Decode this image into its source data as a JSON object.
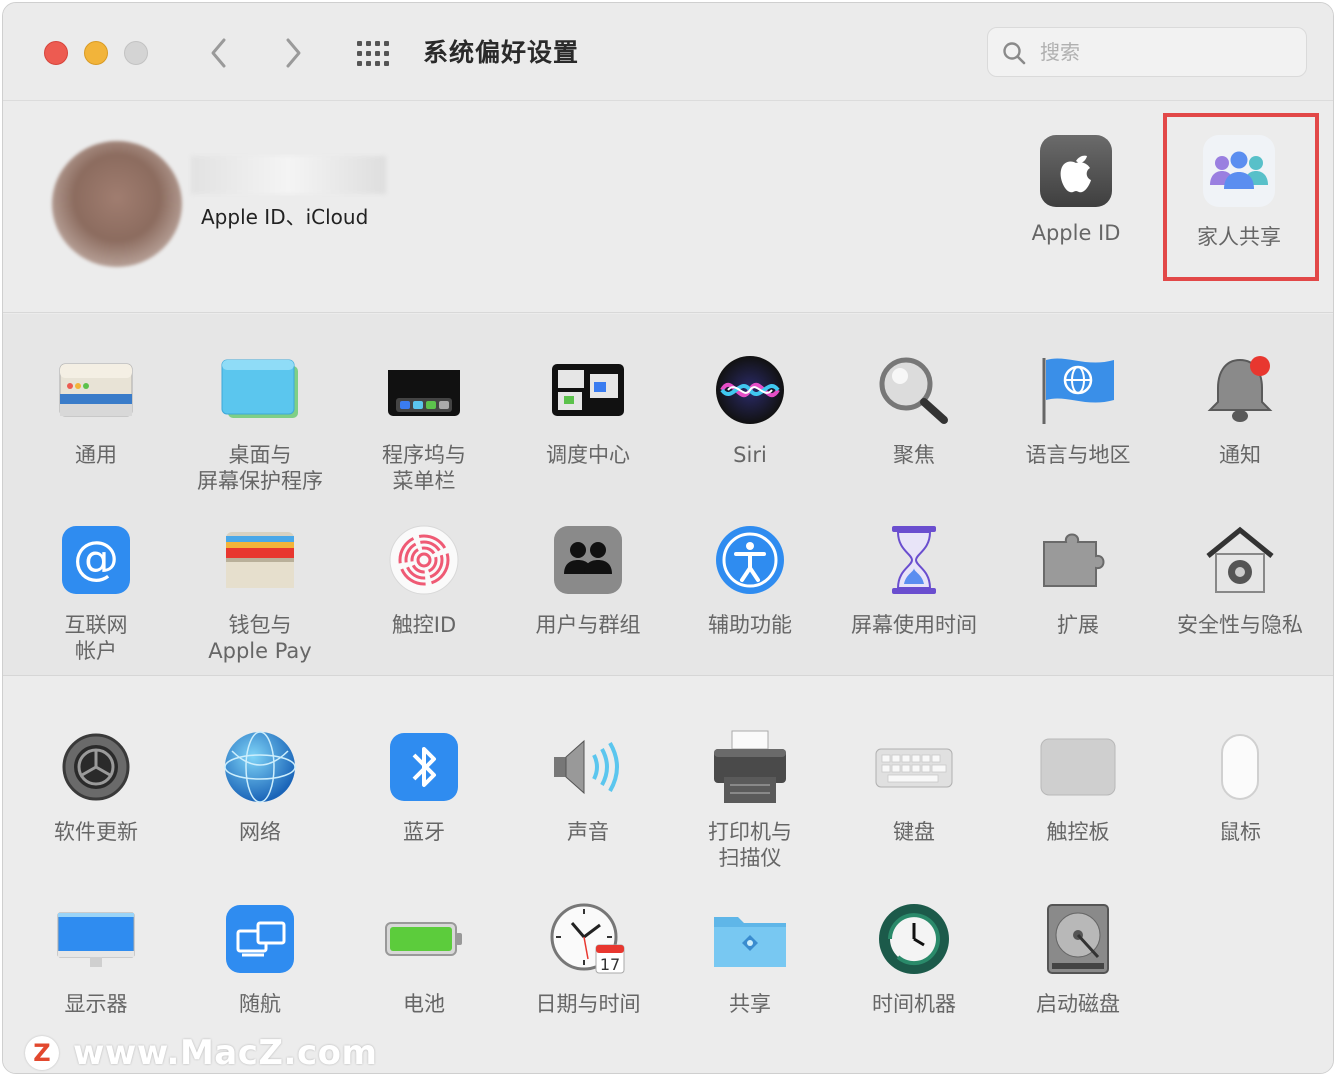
{
  "window": {
    "title": "系统偏好设置",
    "search_placeholder": "搜索"
  },
  "account": {
    "name": "",
    "subtitle": "Apple ID、iCloud",
    "apple_id_label": "Apple ID",
    "family_label": "家人共享"
  },
  "section1": [
    {
      "label": "通用",
      "icon": "general-icon"
    },
    {
      "label": "桌面与\n屏幕保护程序",
      "icon": "desktop-screensaver-icon"
    },
    {
      "label": "程序坞与\n菜单栏",
      "icon": "dock-menubar-icon"
    },
    {
      "label": "调度中心",
      "icon": "mission-control-icon"
    },
    {
      "label": "Siri",
      "icon": "siri-icon"
    },
    {
      "label": "聚焦",
      "icon": "spotlight-icon"
    },
    {
      "label": "语言与地区",
      "icon": "language-region-icon"
    },
    {
      "label": "通知",
      "icon": "notifications-icon"
    },
    {
      "label": "互联网\n帐户",
      "icon": "internet-accounts-icon"
    },
    {
      "label": "钱包与\nApple Pay",
      "icon": "wallet-applepay-icon"
    },
    {
      "label": "触控ID",
      "icon": "touch-id-icon"
    },
    {
      "label": "用户与群组",
      "icon": "users-groups-icon"
    },
    {
      "label": "辅助功能",
      "icon": "accessibility-icon"
    },
    {
      "label": "屏幕使用时间",
      "icon": "screen-time-icon"
    },
    {
      "label": "扩展",
      "icon": "extensions-icon"
    },
    {
      "label": "安全性与隐私",
      "icon": "security-privacy-icon"
    }
  ],
  "section2": [
    {
      "label": "软件更新",
      "icon": "software-update-icon"
    },
    {
      "label": "网络",
      "icon": "network-icon"
    },
    {
      "label": "蓝牙",
      "icon": "bluetooth-icon"
    },
    {
      "label": "声音",
      "icon": "sound-icon"
    },
    {
      "label": "打印机与\n扫描仪",
      "icon": "printers-scanners-icon"
    },
    {
      "label": "键盘",
      "icon": "keyboard-icon"
    },
    {
      "label": "触控板",
      "icon": "trackpad-icon"
    },
    {
      "label": "鼠标",
      "icon": "mouse-icon"
    },
    {
      "label": "显示器",
      "icon": "displays-icon"
    },
    {
      "label": "随航",
      "icon": "sidecar-icon"
    },
    {
      "label": "电池",
      "icon": "battery-icon"
    },
    {
      "label": "日期与时间",
      "icon": "date-time-icon",
      "badge": "17"
    },
    {
      "label": "共享",
      "icon": "sharing-icon"
    },
    {
      "label": "时间机器",
      "icon": "time-machine-icon"
    },
    {
      "label": "启动磁盘",
      "icon": "startup-disk-icon"
    }
  ],
  "watermark": {
    "logo": "Z",
    "text": "www.MacZ.com"
  },
  "colors": {
    "highlight": "#e24848",
    "close": "#ed5b51",
    "minimize": "#f2b43a"
  }
}
